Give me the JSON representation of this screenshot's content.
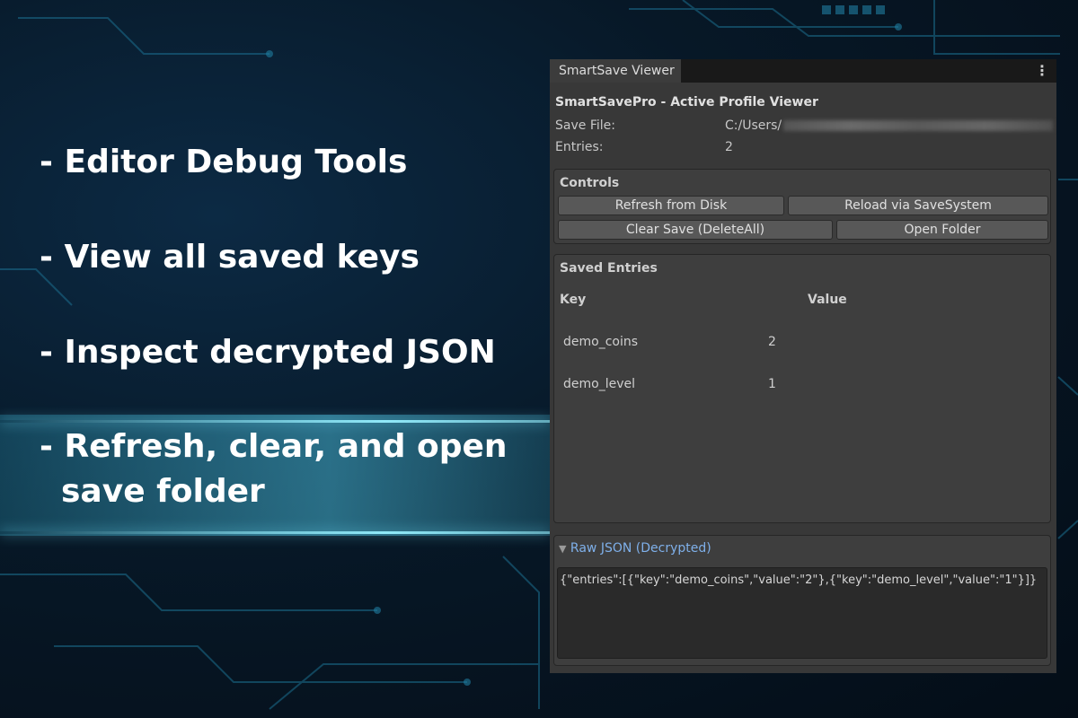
{
  "bullets": [
    "- Editor Debug Tools",
    "- View all saved keys",
    "- Inspect decrypted JSON",
    "- Refresh, clear, and open"
  ],
  "bullet_continuation": "save folder",
  "window": {
    "tab_label": "SmartSave Viewer",
    "menu_icon": "kebab-menu-icon",
    "title": "SmartSavePro - Active Profile Viewer",
    "save_file_label": "Save File:",
    "save_file_value": "C:/Users/",
    "entries_label": "Entries:",
    "entries_value": "2"
  },
  "controls": {
    "title": "Controls",
    "refresh": "Refresh from Disk",
    "reload": "Reload via SaveSystem",
    "clear": "Clear Save (DeleteAll)",
    "open_folder": "Open Folder"
  },
  "saved_entries": {
    "title": "Saved Entries",
    "key_header": "Key",
    "value_header": "Value",
    "rows": [
      {
        "key": "demo_coins",
        "value": "2"
      },
      {
        "key": "demo_level",
        "value": "1"
      }
    ]
  },
  "raw_json": {
    "foldout_icon": "triangle-down-icon",
    "title": "Raw JSON (Decrypted)",
    "content": "{\"entries\":[{\"key\":\"demo_coins\",\"value\":\"2\"},{\"key\":\"demo_level\",\"value\":\"1\"}]}"
  },
  "colors": {
    "panel_bg": "#383838",
    "accent_link": "#7fb0ea",
    "glow": "#96f0ff"
  }
}
